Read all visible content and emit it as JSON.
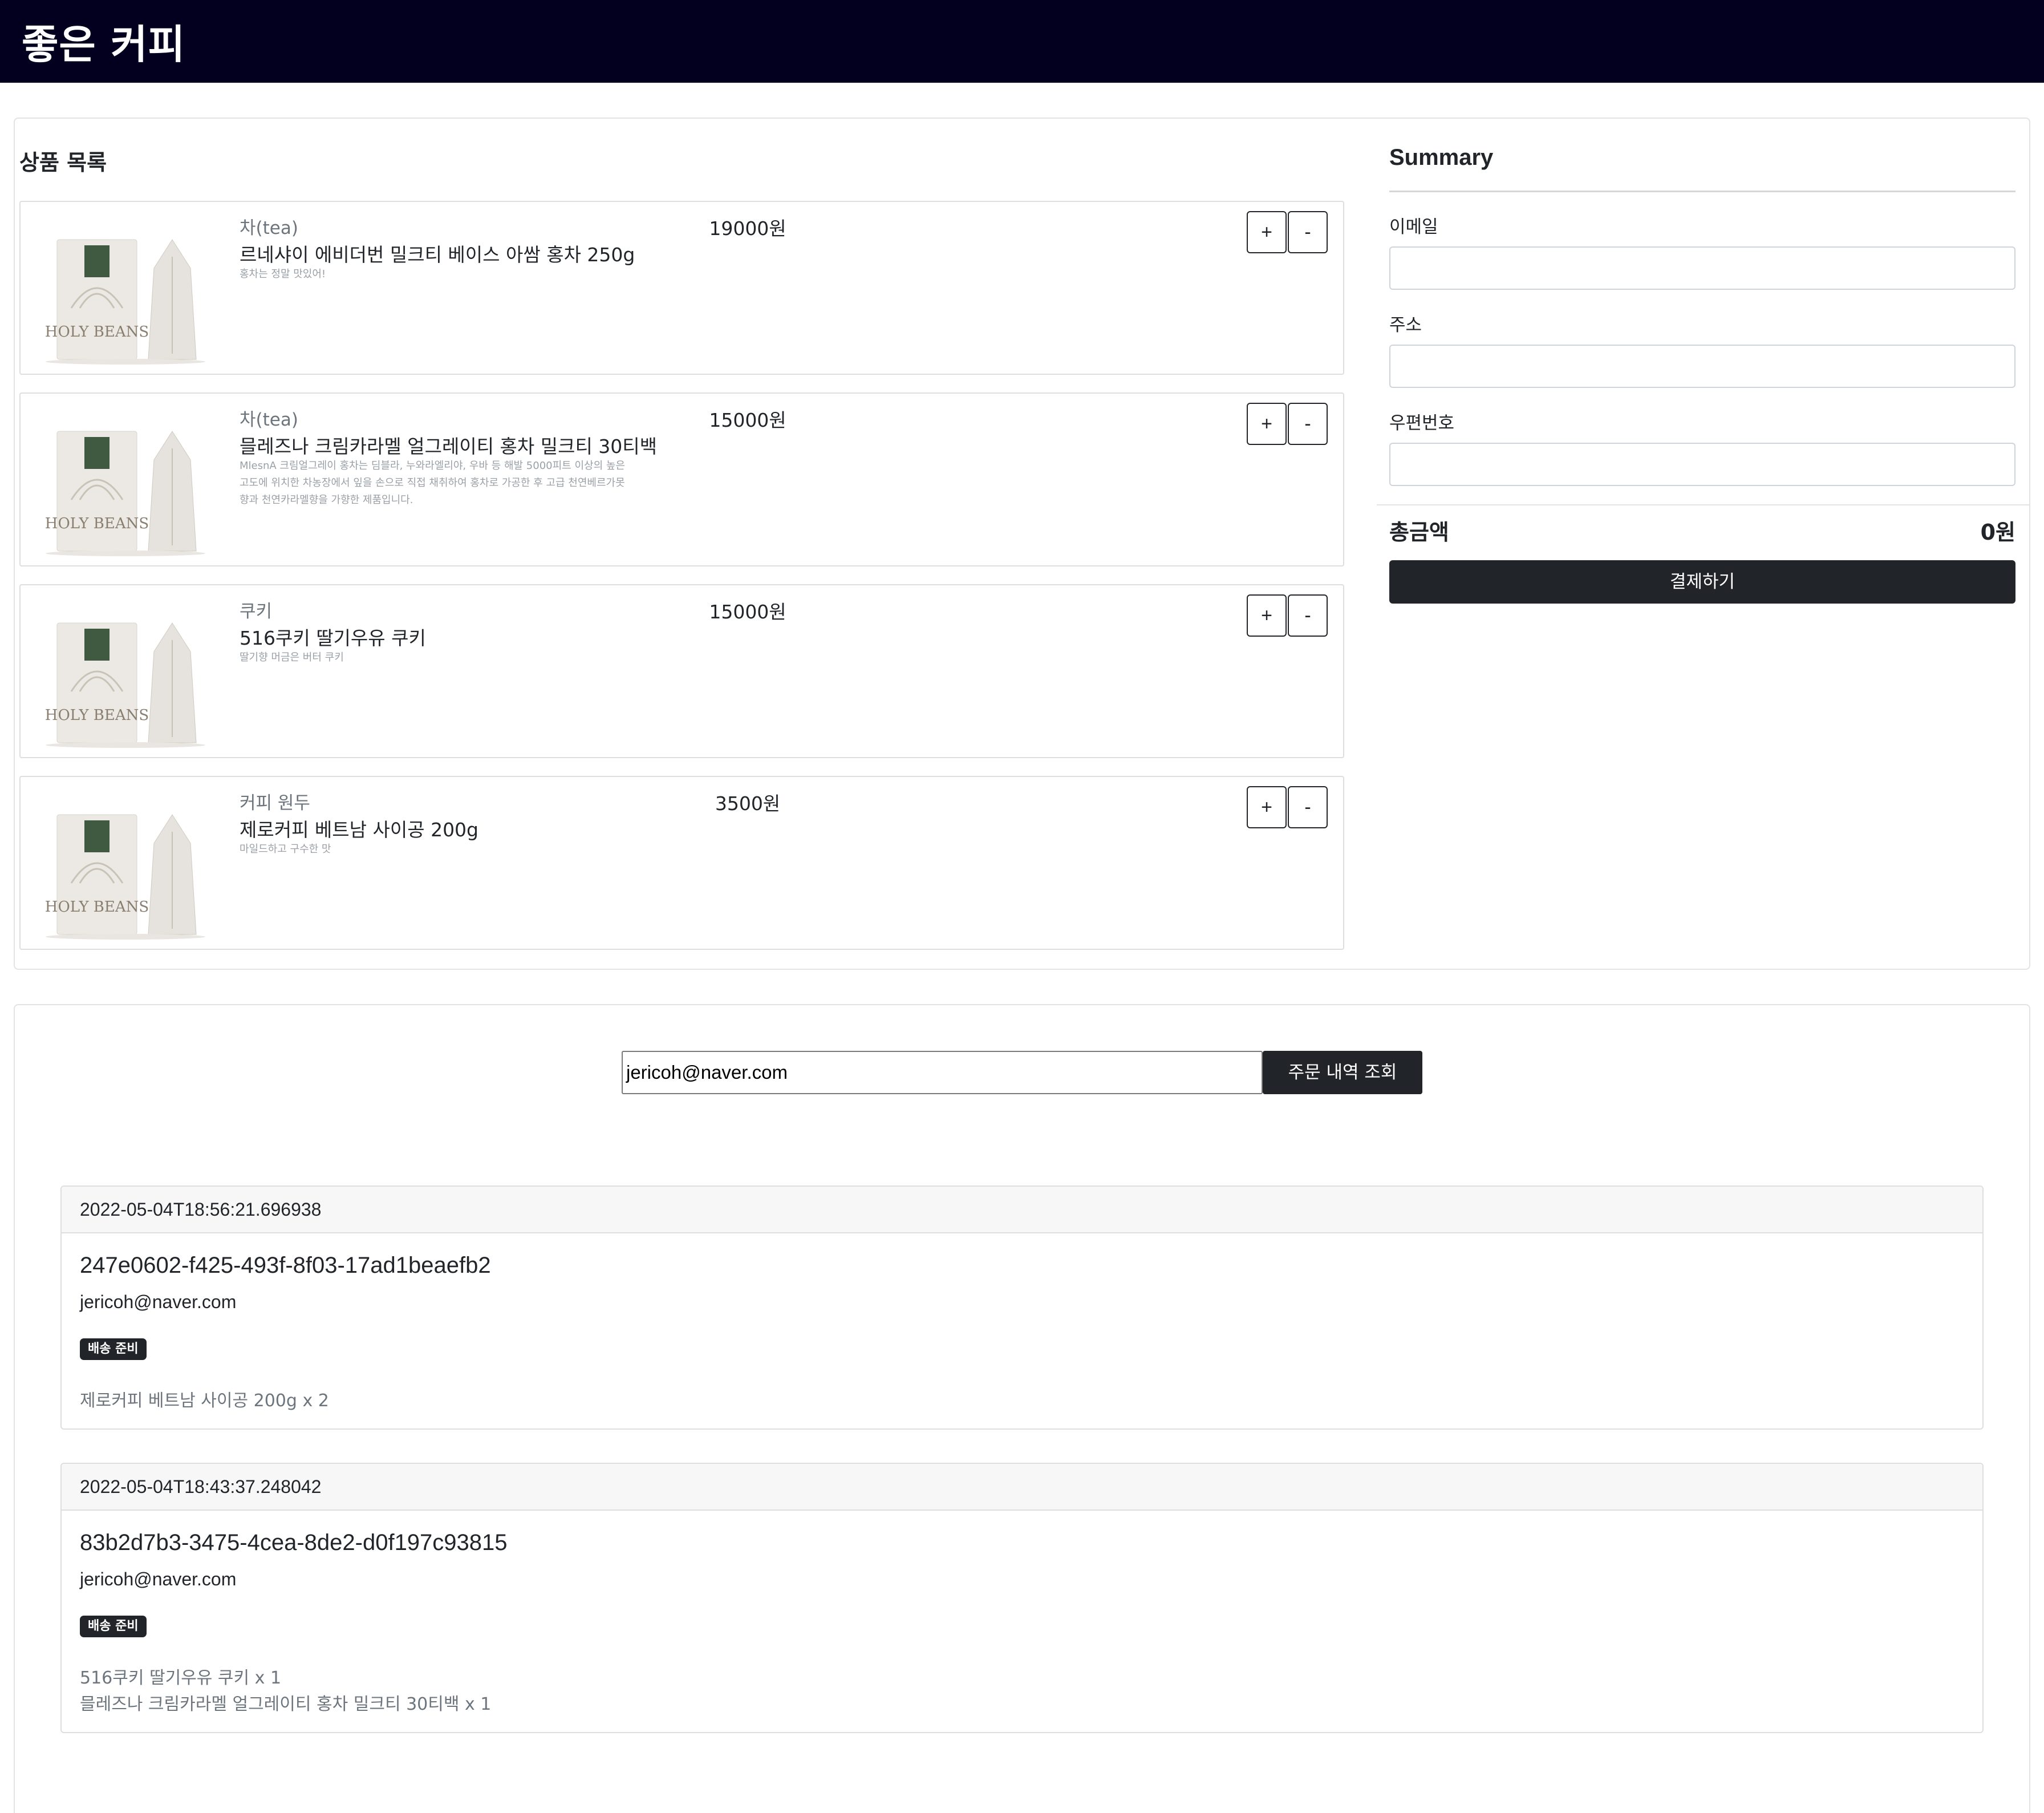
{
  "app": {
    "brand": "좋은 커피"
  },
  "products_section": {
    "title": "상품 목록"
  },
  "products": [
    {
      "category": "차(tea)",
      "name": "르네샤이 에비더번 밀크티 베이스 아쌈 홍차 250g",
      "price": "19000원",
      "description": "홍차는 정말 맛있어!",
      "image_label": "HOLY BEANS"
    },
    {
      "category": "차(tea)",
      "name": "믈레즈나 크림카라멜 얼그레이티 홍차 밀크티 30티백",
      "price": "15000원",
      "description": "MlesnA 크림얼그레이 홍차는 딤블라, 누와라엘리야, 우바 등 해발 5000피트 이상의 높은 고도에 위치한 차농장에서 잎을 손으로 직접 채취하여 홍차로 가공한 후 고급 천연베르가못향과 천연카라멜향을 가향한 제품입니다.",
      "image_label": "HOLY BEANS"
    },
    {
      "category": "쿠키",
      "name": "516쿠키 딸기우유 쿠키",
      "price": "15000원",
      "description": "딸기향 머금은 버터 쿠키",
      "image_label": "HOLY BEANS"
    },
    {
      "category": "커피 원두",
      "name": "제로커피 베트남 사이공 200g",
      "price": "3500원",
      "description": "마일드하고 구수한 맛",
      "image_label": "HOLY BEANS"
    }
  ],
  "quantity_controls": {
    "plus": "+",
    "minus": "-"
  },
  "summary": {
    "title": "Summary",
    "email_label": "이메일",
    "email_value": "",
    "address_label": "주소",
    "address_value": "",
    "postcode_label": "우편번호",
    "postcode_value": "",
    "total_label": "총금액",
    "total_value": "0원",
    "pay_button": "결제하기"
  },
  "lookup": {
    "email_value": "jericoh@naver.com",
    "button": "주문 내역 조회"
  },
  "orders": [
    {
      "created_at": "2022-05-04T18:56:21.696938",
      "order_id": "247e0602-f425-493f-8f03-17ad1beaefb2",
      "email": "jericoh@naver.com",
      "status": "배송 준비",
      "items": [
        "제로커피 베트남 사이공 200g x 2"
      ]
    },
    {
      "created_at": "2022-05-04T18:43:37.248042",
      "order_id": "83b2d7b3-3475-4cea-8de2-d0f197c93815",
      "email": "jericoh@naver.com",
      "status": "배송 준비",
      "items": [
        "516쿠키 딸기우유 쿠키 x 1",
        "믈레즈나 크림카라멜 얼그레이티 홍차 밀크티 30티백 x 1"
      ]
    }
  ],
  "colors": {
    "navbar": "#02001e",
    "dark_button": "#212529",
    "muted_text": "#6c757d",
    "badge": "#212529"
  }
}
